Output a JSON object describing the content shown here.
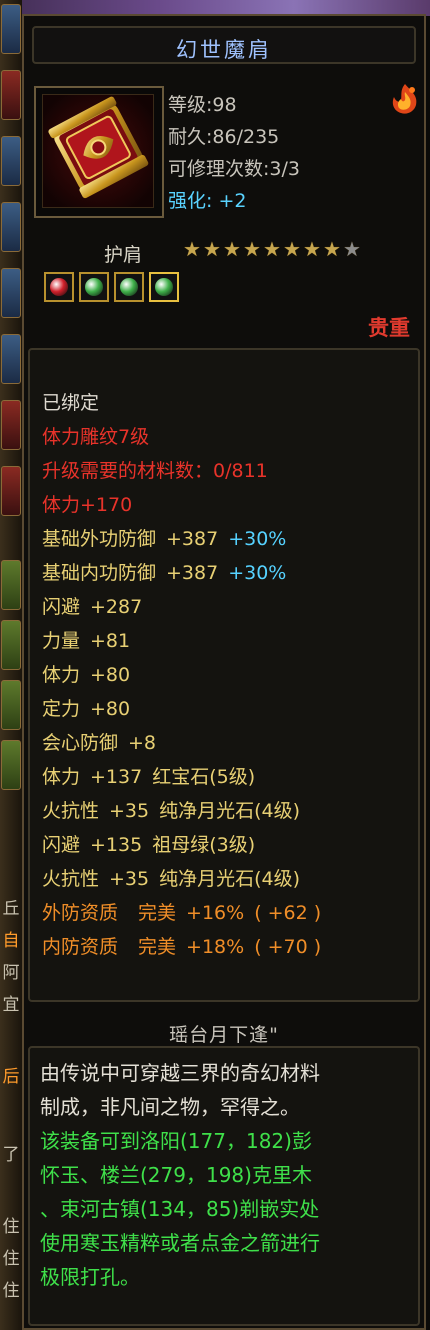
{
  "item": {
    "name": "幻世魔肩",
    "stats": {
      "level": "等级:98",
      "durability": "耐久:86/235",
      "repair_count": "可修理次数:3/3",
      "enhance": "强化: +2"
    },
    "slot_type": "护肩",
    "stars": {
      "total": 9,
      "filled": 8
    },
    "gems": [
      {
        "icon": "red-gem-icon",
        "color": "#d0202a"
      },
      {
        "icon": "green-gem-icon",
        "color": "#3fb04a"
      },
      {
        "icon": "green-gem-icon",
        "color": "#3fb04a"
      },
      {
        "icon": "green-gem-icon",
        "color": "#3fb04a"
      }
    ],
    "rarity": "贵重"
  },
  "attributes": {
    "bound": "已绑定",
    "engrave": "体力雕纹7级",
    "upgrade_materials": "升级需要的材料数：0/811",
    "stamina_bonus": "体力+170",
    "base_outer_defense": {
      "label": "基础外功防御",
      "value": "+387",
      "pct": "+30%"
    },
    "base_inner_defense": {
      "label": "基础内功防御",
      "value": "+387",
      "pct": "+30%"
    },
    "dodge": {
      "label": "闪避",
      "value": "+287"
    },
    "strength": {
      "label": "力量",
      "value": "+81"
    },
    "stamina": {
      "label": "体力",
      "value": "+80"
    },
    "focus": {
      "label": "定力",
      "value": "+80"
    },
    "crit_defense": {
      "label": "会心防御",
      "value": "+8"
    },
    "gem_lines": [
      {
        "label": "体力",
        "value": "+137",
        "gem": "红宝石",
        "gem_level": "(5级)"
      },
      {
        "label": "火抗性",
        "value": "+35",
        "gem": "纯净月光石",
        "gem_level": "(4级)"
      },
      {
        "label": "闪避",
        "value": "+135",
        "gem": "祖母绿",
        "gem_level": "(3级)"
      },
      {
        "label": "火抗性",
        "value": "+35",
        "gem": "纯净月光石",
        "gem_level": "(4级)"
      }
    ],
    "quality_lines": [
      {
        "label": "外防资质",
        "grade": "完美",
        "pct": "+16%",
        "value": "( +62 )"
      },
      {
        "label": "内防资质",
        "grade": "完美",
        "pct": "+18%",
        "value": "( +70 )"
      }
    ]
  },
  "set_name": "瑶台月下逢\"",
  "description": {
    "flavor_lines": [
      "由传说中可穿越三界的奇幻材料",
      "制成，非凡间之物，罕得之。"
    ],
    "hint_lines": [
      "该装备可到洛阳(177，182)彭",
      "怀玉、楼兰(279，198)克里木",
      "、束河古镇(134，85)剃嵌实处",
      "使用寒玉精粹或者点金之箭进行",
      "极限打孔。"
    ]
  },
  "left_strip_glyphs": [
    "丘",
    "自",
    "阿",
    "宜",
    "后",
    "了",
    "住",
    "住",
    "住"
  ]
}
